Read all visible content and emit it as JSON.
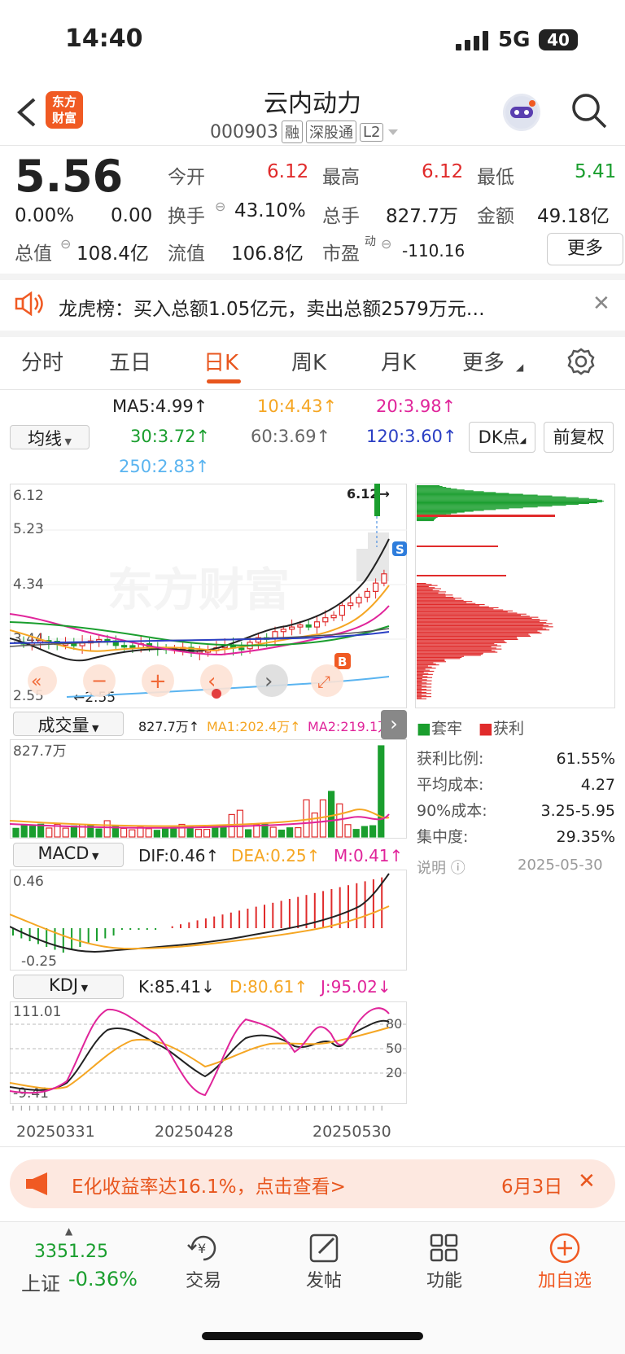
{
  "status_bar": {
    "time": "14:40",
    "network": "5G",
    "battery": "40"
  },
  "header": {
    "logo_text": "东方财富",
    "stock_name": "云内动力",
    "stock_code": "000903",
    "tags": [
      "融",
      "深股通",
      "L2"
    ]
  },
  "quote": {
    "price": "5.56",
    "change_pct": "0.00%",
    "change": "0.00",
    "items": [
      {
        "label": "今开",
        "value": "6.12",
        "color": "#e02b2b"
      },
      {
        "label": "最高",
        "value": "6.12",
        "color": "#e02b2b"
      },
      {
        "label": "最低",
        "value": "5.41",
        "color": "#1a9e2e"
      },
      {
        "label": "换手",
        "value": "43.10%",
        "color": "#222222"
      },
      {
        "label": "总手",
        "value": "827.7万",
        "color": "#222222"
      },
      {
        "label": "金额",
        "value": "49.18亿",
        "color": "#222222"
      },
      {
        "label": "总值",
        "value": "108.4亿",
        "color": "#222222"
      },
      {
        "label": "流值",
        "value": "106.8亿",
        "color": "#222222"
      },
      {
        "label": "市盈",
        "value": "-110.16",
        "color": "#222222"
      }
    ],
    "pe_sup": "动",
    "more_label": "更多"
  },
  "lhb": {
    "text": "龙虎榜：买入总额1.05亿元，卖出总额2579万元…"
  },
  "tabs": [
    "分时",
    "五日",
    "日K",
    "周K",
    "月K",
    "更多",
    ""
  ],
  "active_tab": "日K",
  "ma": {
    "selector": "均线",
    "ma5": "MA5:4.99↑",
    "ma10": "10:4.43↑",
    "ma20": "20:3.98↑",
    "ma30": "30:3.72↑",
    "ma60": "60:3.69↑",
    "ma120": "120:3.60↑",
    "ma250": "250:2.83↑",
    "dk": "DK点",
    "fq": "前复权"
  },
  "kline": {
    "y_labels": [
      "6.12",
      "5.23",
      "4.34",
      "3.44",
      "2.55"
    ],
    "high_label": "6.12→",
    "low_label": "←2.55",
    "watermark": "东方财富",
    "markers": {
      "s": "S",
      "b": "B"
    }
  },
  "chip": {
    "legend1": "套牢",
    "legend2": "获利",
    "rows": [
      {
        "label": "获利比例:",
        "value": "61.55%"
      },
      {
        "label": "平均成本:",
        "value": "4.27"
      },
      {
        "label": "90%成本:",
        "value": "3.25-5.95"
      },
      {
        "label": "集中度:",
        "value": "29.35%"
      }
    ],
    "note_label": "说明",
    "date": "2025-05-30"
  },
  "volume": {
    "selector": "成交量",
    "vol": "827.7万↑",
    "ma1": "MA1:202.4万↑",
    "ma2": "MA2:219.1万",
    "y_label": "827.7万"
  },
  "macd": {
    "selector": "MACD",
    "dif": "DIF:0.46↑",
    "dea": "DEA:0.25↑",
    "m": "M:0.41↑",
    "y_top": "0.46",
    "y_bottom": "-0.25"
  },
  "kdj": {
    "selector": "KDJ",
    "k": "K:85.41↓",
    "d": "D:80.61↑",
    "j": "J:95.02↓",
    "y_top": "111.01",
    "y_bottom": "-9.41",
    "levels": [
      "80",
      "50",
      "20"
    ]
  },
  "dates": [
    "20250331",
    "20250428",
    "20250530"
  ],
  "promo": {
    "text": "E化收益率达16.1%，点击查看>",
    "date": "6月3日"
  },
  "bottom_nav": {
    "index_value": "3351.25",
    "index_name": "上证",
    "index_change": "-0.36%",
    "items": [
      "交易",
      "发帖",
      "功能",
      "加自选"
    ]
  }
}
